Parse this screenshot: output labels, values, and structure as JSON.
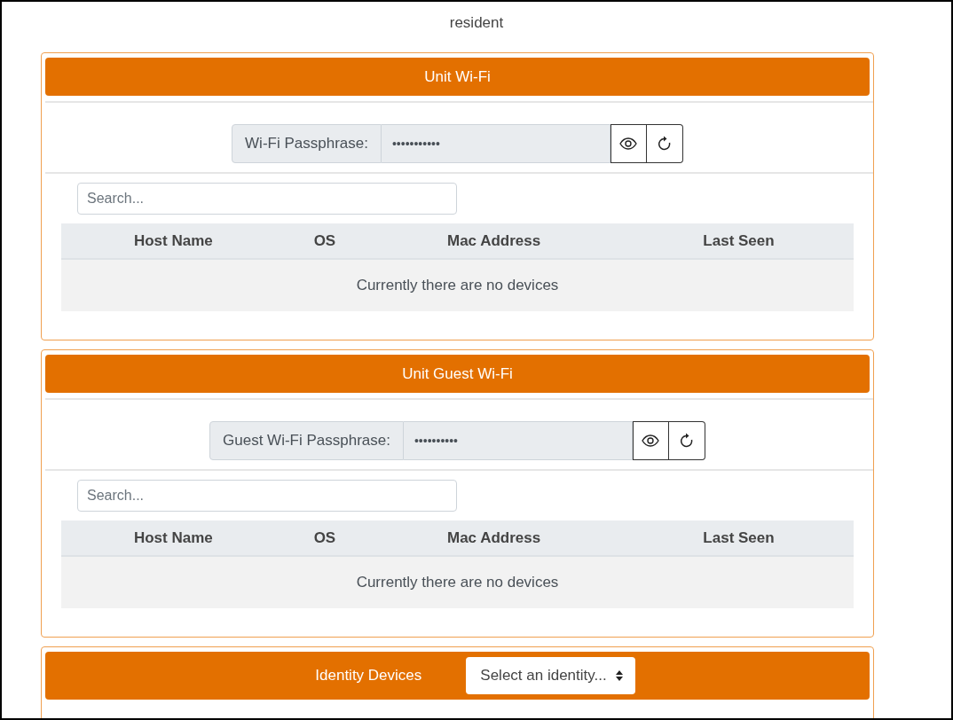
{
  "page_title": "resident",
  "cards": [
    {
      "kind": "network",
      "title": "Unit Wi-Fi",
      "passphrase": {
        "label": "Wi-Fi Passphrase:",
        "value": "•••••••••••"
      },
      "search": {
        "placeholder": "Search..."
      },
      "table": {
        "columns": [
          "Host Name",
          "OS",
          "Mac Address",
          "Last Seen"
        ],
        "empty_message": "Currently there are no devices"
      }
    },
    {
      "kind": "network",
      "title": "Unit Guest Wi-Fi",
      "passphrase": {
        "label": "Guest Wi-Fi Passphrase:",
        "value": "••••••••••"
      },
      "search": {
        "placeholder": "Search..."
      },
      "table": {
        "columns": [
          "Host Name",
          "OS",
          "Mac Address",
          "Last Seen"
        ],
        "empty_message": "Currently there are no devices"
      }
    },
    {
      "kind": "identity",
      "title": "Identity Devices",
      "select": {
        "value": "Select an identity..."
      }
    }
  ]
}
